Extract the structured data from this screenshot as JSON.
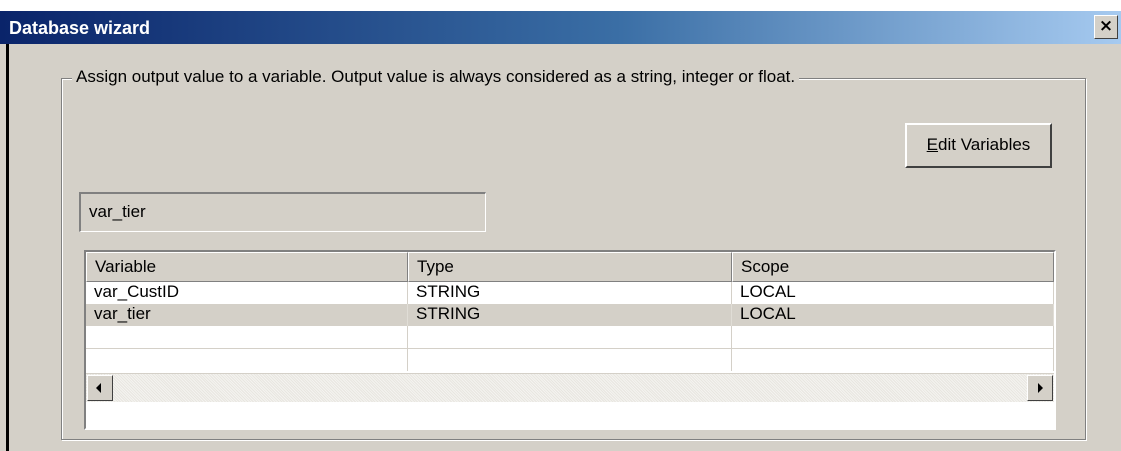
{
  "window": {
    "title": "Database wizard",
    "close_glyph": "×",
    "close_icon": "close-icon"
  },
  "group": {
    "label": "Assign output value to a variable. Output value is always considered as a string, integer or float."
  },
  "edit_variables_button": {
    "mnemonic": "E",
    "label_rest": "dit Variables"
  },
  "selected_variable": {
    "value": "var_tier"
  },
  "variables_table": {
    "columns": [
      "Variable",
      "Type",
      "Scope"
    ],
    "rows": [
      [
        "var_CustID",
        "STRING",
        "LOCAL"
      ],
      [
        "var_tier",
        "STRING",
        "LOCAL"
      ]
    ]
  },
  "scrollbar": {
    "left_icon": "scroll-left-arrow-icon",
    "right_icon": "scroll-right-arrow-icon"
  },
  "colors": {
    "title_gradient_start": "#0a246a",
    "title_gradient_end": "#a6caf0",
    "dialog_face": "#d4d0c8",
    "alt_row": "#d4d0c8"
  }
}
